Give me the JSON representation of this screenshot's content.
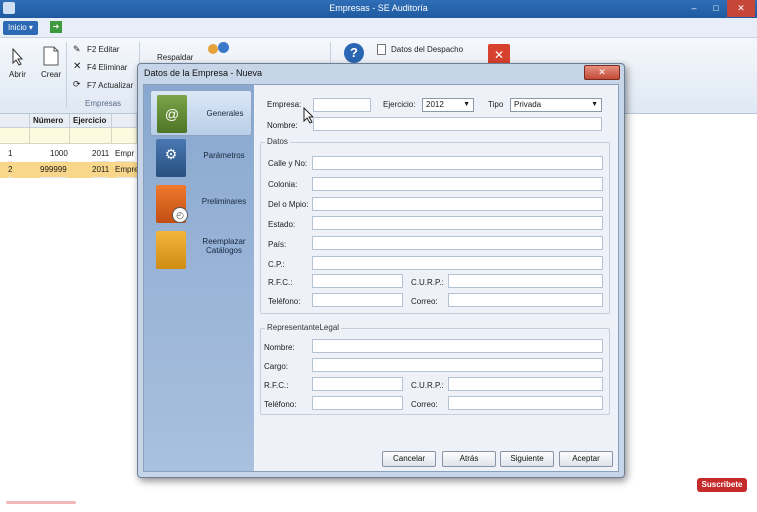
{
  "app": {
    "title": "Empresas - SE Auditoría",
    "menu_label": "Inicio ▾",
    "window_controls": {
      "minimize": "–",
      "maximize": "□",
      "close": "✕"
    }
  },
  "ribbon": {
    "abrir": "Abrir",
    "crear": "Crear",
    "editar": "F2 Editar",
    "eliminar": "F4 Eliminar",
    "actualizar": "F7 Actualizar",
    "group_empresas": "Empresas",
    "respaldar": "Respaldar",
    "datos_despacho": "Datos del Despacho"
  },
  "grid": {
    "headers": [
      "Número",
      "Ejercicio"
    ],
    "rows": [
      {
        "n": "1",
        "numero": "1000",
        "ejercicio": "2011",
        "nombre": "Empr"
      },
      {
        "n": "2",
        "numero": "999999",
        "ejercicio": "2011",
        "nombre": "Empre"
      }
    ]
  },
  "dialog": {
    "title": "Datos de la Empresa - Nueva",
    "close": "✕",
    "nav": [
      {
        "label": "Generales",
        "icon": "at-sign-icon"
      },
      {
        "label": "Parámetros",
        "icon": "gear-icon"
      },
      {
        "label": "Preliminares",
        "icon": "clock-icon"
      },
      {
        "label": "Reemplazar Catálogos",
        "icon": "document-icon"
      }
    ],
    "top": {
      "empresa_label": "Empresa:",
      "empresa_value": "",
      "ejercicio_label": "Ejercicio:",
      "ejercicio_value": "2012",
      "tipo_label": "Tipo",
      "tipo_value": "Privada",
      "nombre_label": "Nombre:",
      "nombre_value": ""
    },
    "datos": {
      "title": "Datos",
      "calle": "Calle y No:",
      "colonia": "Colonia:",
      "del_mpio": "Del o Mpio:",
      "estado": "Estado:",
      "pais": "País:",
      "cp": "C.P.:",
      "rfc": "R.F.C.:",
      "curp": "C.U.R.P.:",
      "telefono": "Teléfono:",
      "correo": "Correo:"
    },
    "representante": {
      "title": "RepresentanteLegal",
      "nombre": "Nombre:",
      "cargo": "Cargo:",
      "rfc": "R.F.C.:",
      "curp": "C.U.R.P.:",
      "telefono": "Teléfono:",
      "correo": "Correo:"
    },
    "buttons": {
      "cancelar": "Cancelar",
      "atras": "Atrás",
      "siguiente": "Siguiente",
      "aceptar": "Aceptar"
    }
  },
  "overlay": {
    "suscribete": "Suscribete"
  },
  "colors": {
    "titlebar": "#2f6fb8",
    "accent_selected_row": "#f8d68a",
    "close_red": "#c24a37",
    "nav_pane": "#9bb5d8"
  }
}
